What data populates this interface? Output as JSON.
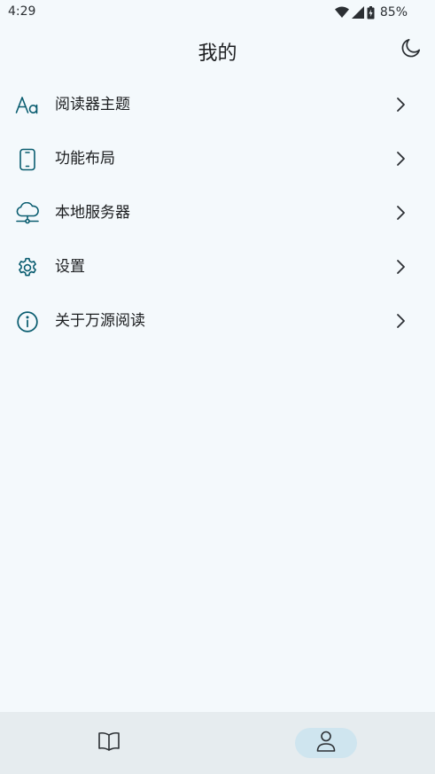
{
  "status_bar": {
    "time": "4:29",
    "battery": "85%"
  },
  "header": {
    "title": "我的"
  },
  "menu": {
    "items": [
      {
        "label": "阅读器主题",
        "icon": "reader-theme-icon"
      },
      {
        "label": "功能布局",
        "icon": "phone-layout-icon"
      },
      {
        "label": "本地服务器",
        "icon": "cloud-server-icon"
      },
      {
        "label": "设置",
        "icon": "gear-icon"
      },
      {
        "label": "关于万源阅读",
        "icon": "info-icon"
      }
    ]
  },
  "bottom_nav": {
    "items": [
      {
        "icon": "book-icon",
        "active": false
      },
      {
        "icon": "person-icon",
        "active": true
      }
    ]
  },
  "colors": {
    "accent": "#0a5d70",
    "background": "#f4f9fc",
    "nav_background": "#e6ecef",
    "nav_active": "#cfe5ef"
  }
}
